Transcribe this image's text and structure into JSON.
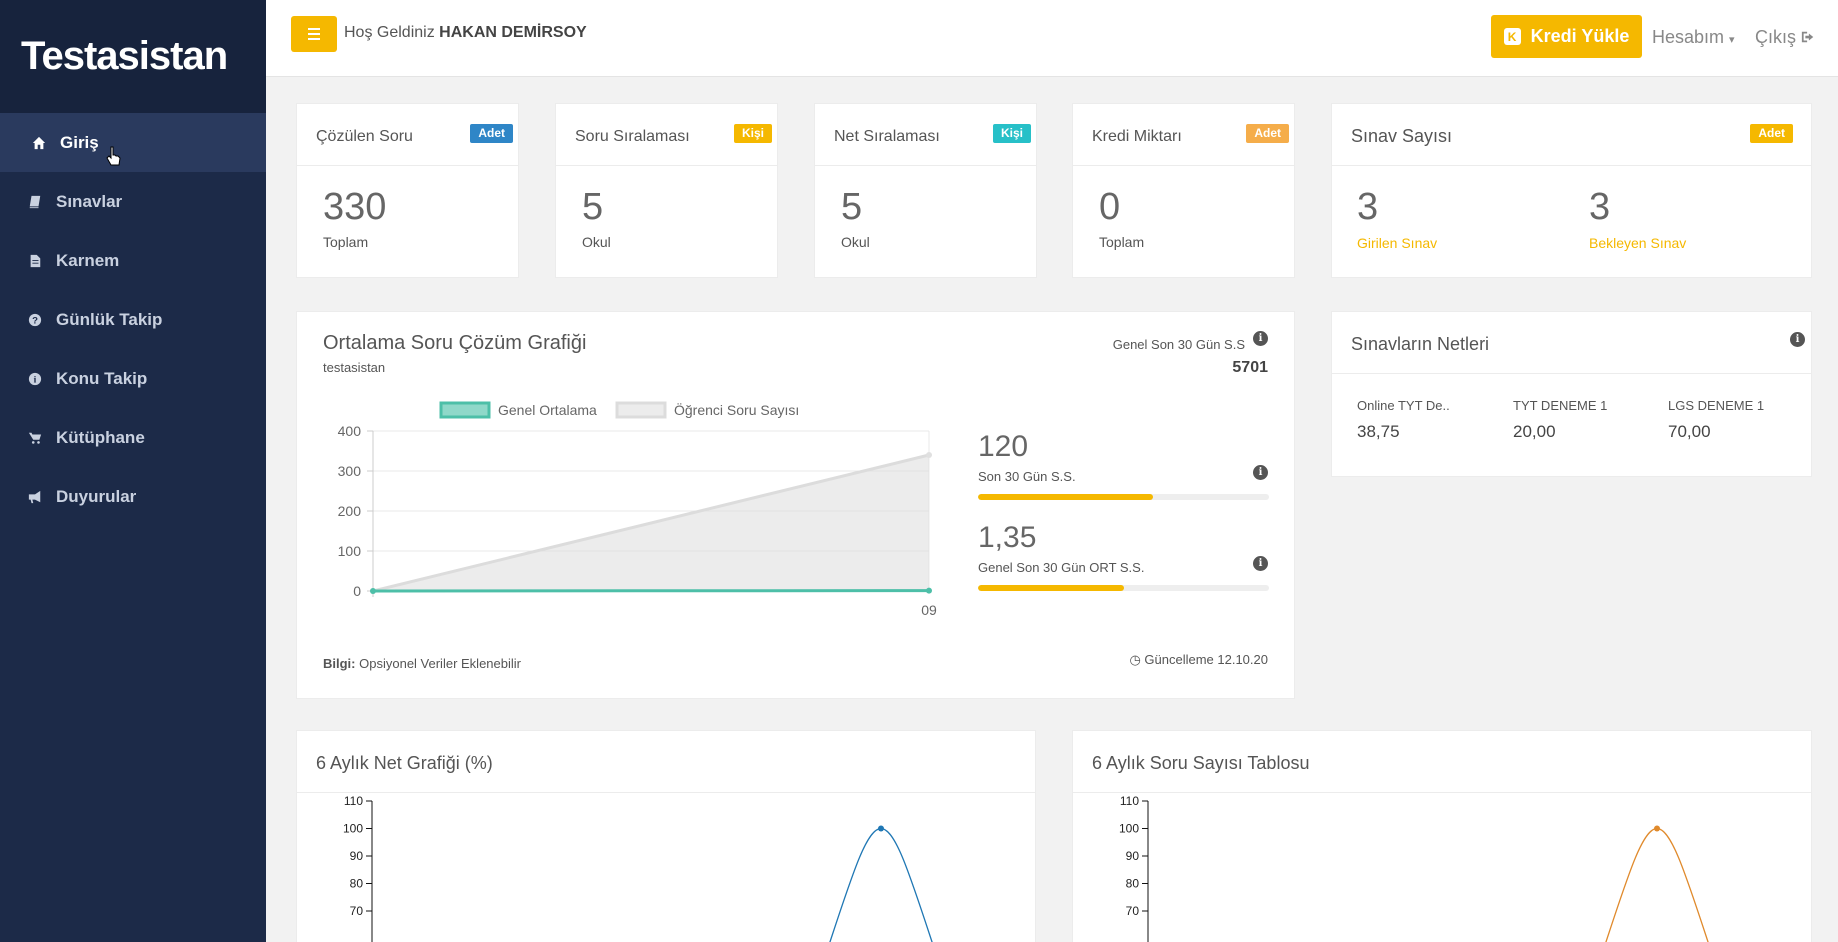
{
  "brand": {
    "logo": "Testasistan"
  },
  "sidebar": {
    "items": [
      {
        "label": "Giriş",
        "icon": "home-icon"
      },
      {
        "label": "Sınavlar",
        "icon": "book-icon"
      },
      {
        "label": "Karnem",
        "icon": "file-icon"
      },
      {
        "label": "Günlük Takip",
        "icon": "question-icon"
      },
      {
        "label": "Konu Takip",
        "icon": "info-icon"
      },
      {
        "label": "Kütüphane",
        "icon": "cart-icon"
      },
      {
        "label": "Duyurular",
        "icon": "bullhorn-icon"
      }
    ]
  },
  "topbar": {
    "welcome_prefix": "Hoş Geldiniz",
    "user_name": "HAKAN DEMİRSOY",
    "kredi_label": "Kredi Yükle",
    "hesabim_label": "Hesabım",
    "cikis_label": "Çıkış"
  },
  "stats": {
    "cozulen": {
      "title": "Çözülen Soru",
      "badge": "Adet",
      "value": "330",
      "sub": "Toplam"
    },
    "soru_siralamasi": {
      "title": "Soru Sıralaması",
      "badge": "Kişi",
      "value": "5",
      "sub": "Okul"
    },
    "net_siralamasi": {
      "title": "Net Sıralaması",
      "badge": "Kişi",
      "value": "5",
      "sub": "Okul"
    },
    "kredi": {
      "title": "Kredi Miktarı",
      "badge": "Adet",
      "value": "0",
      "sub": "Toplam"
    },
    "sinav": {
      "title": "Sınav Sayısı",
      "badge": "Adet",
      "girilen_value": "3",
      "girilen_label": "Girilen Sınav",
      "bekleyen_value": "3",
      "bekleyen_label": "Bekleyen Sınav"
    }
  },
  "ortalama": {
    "title": "Ortalama Soru Çözüm Grafiği",
    "subtitle": "testasistan",
    "genel_label": "Genel Son 30 Gün S.S",
    "genel_value": "5701",
    "metric1_value": "120",
    "metric1_label": "Son 30 Gün S.S.",
    "metric1_progress": 0.6,
    "metric2_value": "1,35",
    "metric2_label": "Genel Son 30 Gün ORT S.S.",
    "metric2_progress": 0.5,
    "bilgi_label": "Bilgi:",
    "bilgi_text": "Opsiyonel Veriler Eklenebilir",
    "guncelleme": "Güncelleme 12.10.20"
  },
  "netler": {
    "title": "Sınavların Netleri",
    "items": [
      {
        "name": "Online TYT De..",
        "value": "38,75"
      },
      {
        "name": "TYT DENEME 1",
        "value": "20,00"
      },
      {
        "name": "LGS DENEME 1",
        "value": "70,00"
      }
    ]
  },
  "net_grafik": {
    "title": "6 Aylık Net Grafiği (%)"
  },
  "soru_tablosu": {
    "title": "6 Aylık Soru Sayısı Tablosu"
  },
  "colors": {
    "accent": "#f5b800",
    "sidebar": "#1c2a48",
    "teal": "#4dbfa8",
    "blue_line": "#1f77b4",
    "orange_line": "#e08a2c"
  },
  "chart_data": [
    {
      "type": "area",
      "title": "",
      "legend": [
        "Genel Ortalama",
        "Öğrenci Soru Sayısı"
      ],
      "legend_position": "top",
      "categories": [
        "",
        "09"
      ],
      "series": [
        {
          "name": "Genel Ortalama",
          "values": [
            0,
            1
          ]
        },
        {
          "name": "Öğrenci Soru Sayısı",
          "values": [
            0,
            340
          ]
        }
      ],
      "yticks": [
        0,
        100,
        200,
        300,
        400
      ],
      "ylim": [
        0,
        400
      ]
    },
    {
      "type": "line",
      "title": "6 Aylık Net Grafiği (%)",
      "yticks": [
        70,
        80,
        90,
        100,
        110
      ],
      "visible_ylim": [
        65,
        110
      ],
      "series": [
        {
          "peak_value": 100
        }
      ]
    },
    {
      "type": "line",
      "title": "6 Aylık Soru Sayısı Tablosu",
      "yticks": [
        70,
        80,
        90,
        100,
        110
      ],
      "visible_ylim": [
        65,
        110
      ],
      "series": [
        {
          "peak_value": 100
        }
      ]
    }
  ]
}
